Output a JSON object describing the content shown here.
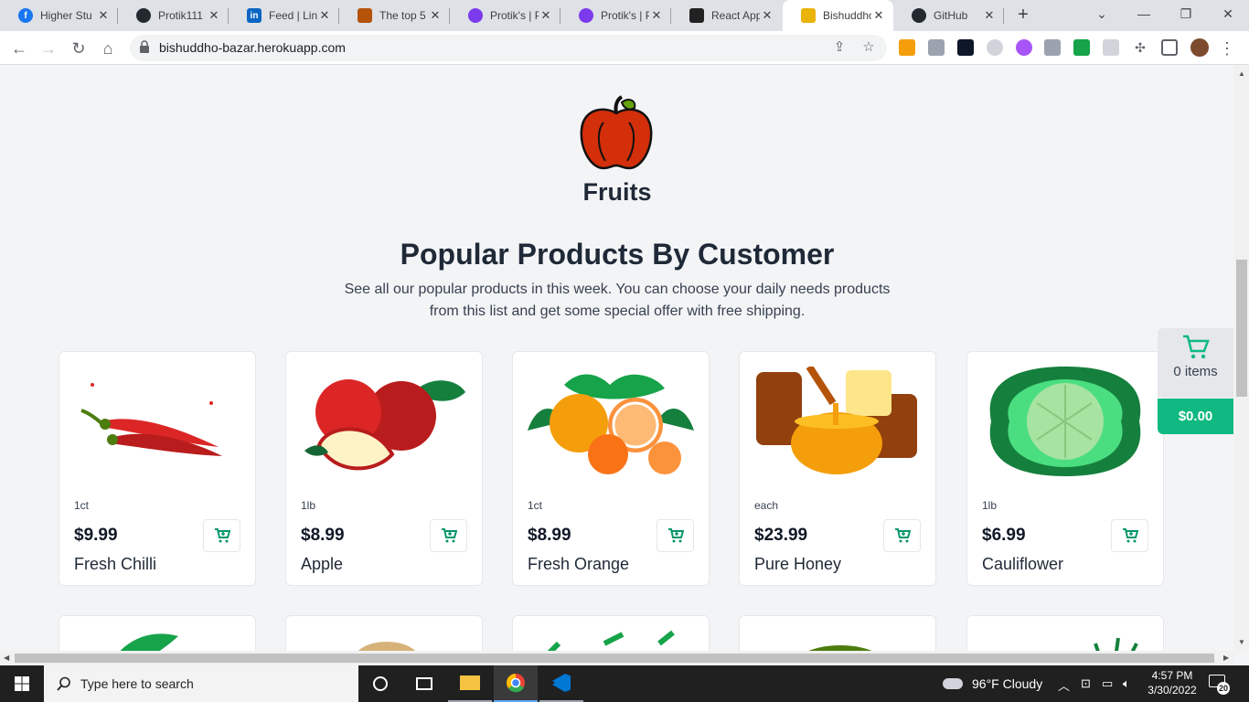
{
  "browser": {
    "tabs": [
      {
        "title": "Higher Stu",
        "icon": "facebook-icon",
        "color": "#1877f2"
      },
      {
        "title": "Protik111 (",
        "icon": "github-icon",
        "color": "#24292f"
      },
      {
        "title": "Feed | Link",
        "icon": "linkedin-icon",
        "color": "#0a66c2"
      },
      {
        "title": "The top 5",
        "icon": "temple-icon",
        "color": "#b45309"
      },
      {
        "title": "Protik's | P",
        "icon": "portfolio-icon",
        "color": "#7c3aed"
      },
      {
        "title": "Protik's | P",
        "icon": "portfolio-icon",
        "color": "#7c3aed"
      },
      {
        "title": "React App",
        "icon": "react-icon",
        "color": "#222222"
      },
      {
        "title": "Bishuddho",
        "icon": "cart-favicon-icon",
        "color": "#eab308"
      },
      {
        "title": "GitHub",
        "icon": "github-icon",
        "color": "#24292f"
      }
    ],
    "url": "bishuddho-bazar.herokuapp.com"
  },
  "page": {
    "category": "Fruits",
    "section_title": "Popular Products By Customer",
    "section_desc": "See all our popular products in this week. You can choose your daily needs products from this list and get some special offer with free shipping."
  },
  "products": [
    {
      "unit": "1ct",
      "price": "$9.99",
      "name": "Fresh Chilli"
    },
    {
      "unit": "1lb",
      "price": "$8.99",
      "name": "Apple"
    },
    {
      "unit": "1ct",
      "price": "$8.99",
      "name": "Fresh Orange"
    },
    {
      "unit": "each",
      "price": "$23.99",
      "name": "Pure Honey"
    },
    {
      "unit": "1lb",
      "price": "$6.99",
      "name": "Cauliflower"
    }
  ],
  "cart": {
    "items": "0 items",
    "total": "$0.00"
  },
  "taskbar": {
    "search_placeholder": "Type here to search",
    "weather": "96°F  Cloudy",
    "time": "4:57 PM",
    "date": "3/30/2022",
    "notifications": "20"
  },
  "colors": {
    "accent": "#10b981",
    "page_bg": "#f3f4f6"
  }
}
